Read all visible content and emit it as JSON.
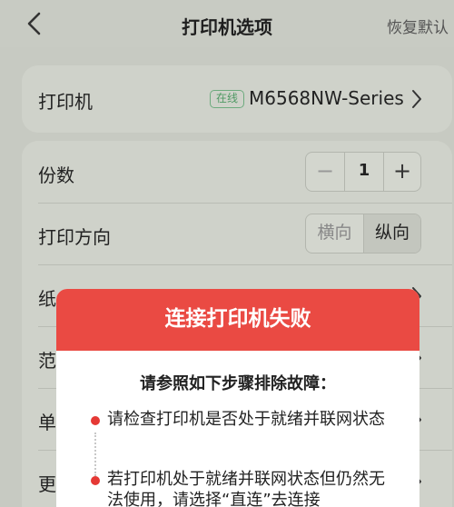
{
  "header": {
    "title": "打印机选项",
    "reset_label": "恢复默认"
  },
  "printer": {
    "label": "打印机",
    "status": "在线",
    "name": "M6568NW-Series"
  },
  "copies": {
    "label": "份数",
    "minus": "−",
    "value": "1",
    "plus": "+"
  },
  "orientation": {
    "label": "打印方向",
    "options": [
      "横向",
      "纵向"
    ],
    "selected": "纵向"
  },
  "settings_rows": [
    "纸",
    "范",
    "单",
    "更"
  ],
  "dialog": {
    "title": "连接打印机失败",
    "subtitle": "请参照如下步骤排除故障：",
    "steps": [
      "请检查打印机是否处于就绪并联网状态",
      "若打印机处于就绪并联网状态但仍然无法使用，请选择“直连”去连接"
    ]
  },
  "colors": {
    "dialog_header": "#ea4a43",
    "bullet": "#e53935",
    "online_badge": "#4f9964",
    "background": "#c7cac2"
  }
}
